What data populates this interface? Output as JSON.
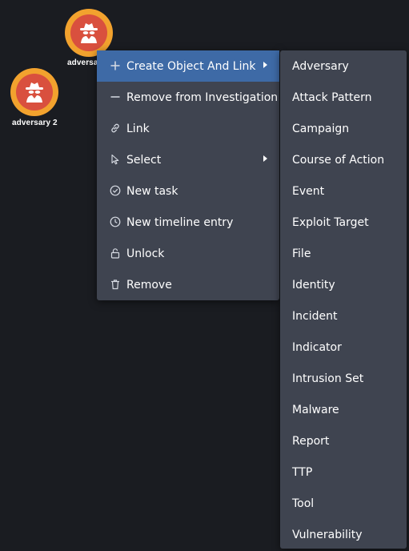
{
  "graph": {
    "nodes": [
      {
        "label": "adversa",
        "icon": "spy-icon"
      },
      {
        "label": "adversary 2",
        "icon": "spy-icon"
      }
    ]
  },
  "colors": {
    "background": "#1a1c21",
    "menu_bg": "#3f4450",
    "menu_active": "#3e6aa6",
    "node_ring": "#f2a22e",
    "node_fill": "#d9503e",
    "text": "#ffffff"
  },
  "context_menu": {
    "items": [
      {
        "label": "Create Object And Link",
        "icon": "plus-icon",
        "has_submenu": true,
        "active": true
      },
      {
        "label": "Remove from Investigation",
        "icon": "minus-icon",
        "has_submenu": false
      },
      {
        "label": "Link",
        "icon": "link-icon",
        "has_submenu": false
      },
      {
        "label": "Select",
        "icon": "pointer-icon",
        "has_submenu": true
      },
      {
        "label": "New task",
        "icon": "check-circle-icon",
        "has_submenu": false
      },
      {
        "label": "New timeline entry",
        "icon": "clock-icon",
        "has_submenu": false
      },
      {
        "label": "Unlock",
        "icon": "unlock-icon",
        "has_submenu": false
      },
      {
        "label": "Remove",
        "icon": "trash-icon",
        "has_submenu": false
      }
    ]
  },
  "submenu": {
    "items": [
      "Adversary",
      "Attack Pattern",
      "Campaign",
      "Course of Action",
      "Event",
      "Exploit Target",
      "File",
      "Identity",
      "Incident",
      "Indicator",
      "Intrusion Set",
      "Malware",
      "Report",
      "TTP",
      "Tool",
      "Vulnerability"
    ]
  }
}
